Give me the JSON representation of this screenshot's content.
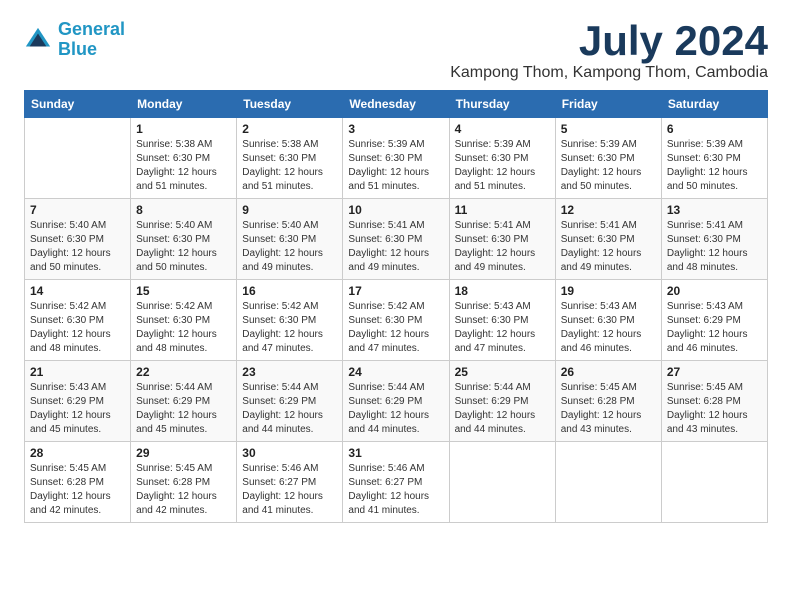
{
  "logo": {
    "line1": "General",
    "line2": "Blue"
  },
  "title": "July 2024",
  "subtitle": "Kampong Thom, Kampong Thom, Cambodia",
  "days_of_week": [
    "Sunday",
    "Monday",
    "Tuesday",
    "Wednesday",
    "Thursday",
    "Friday",
    "Saturday"
  ],
  "weeks": [
    [
      {
        "day": "",
        "sunrise": "",
        "sunset": "",
        "daylight": ""
      },
      {
        "day": "1",
        "sunrise": "Sunrise: 5:38 AM",
        "sunset": "Sunset: 6:30 PM",
        "daylight": "Daylight: 12 hours and 51 minutes."
      },
      {
        "day": "2",
        "sunrise": "Sunrise: 5:38 AM",
        "sunset": "Sunset: 6:30 PM",
        "daylight": "Daylight: 12 hours and 51 minutes."
      },
      {
        "day": "3",
        "sunrise": "Sunrise: 5:39 AM",
        "sunset": "Sunset: 6:30 PM",
        "daylight": "Daylight: 12 hours and 51 minutes."
      },
      {
        "day": "4",
        "sunrise": "Sunrise: 5:39 AM",
        "sunset": "Sunset: 6:30 PM",
        "daylight": "Daylight: 12 hours and 51 minutes."
      },
      {
        "day": "5",
        "sunrise": "Sunrise: 5:39 AM",
        "sunset": "Sunset: 6:30 PM",
        "daylight": "Daylight: 12 hours and 50 minutes."
      },
      {
        "day": "6",
        "sunrise": "Sunrise: 5:39 AM",
        "sunset": "Sunset: 6:30 PM",
        "daylight": "Daylight: 12 hours and 50 minutes."
      }
    ],
    [
      {
        "day": "7",
        "sunrise": "Sunrise: 5:40 AM",
        "sunset": "Sunset: 6:30 PM",
        "daylight": "Daylight: 12 hours and 50 minutes."
      },
      {
        "day": "8",
        "sunrise": "Sunrise: 5:40 AM",
        "sunset": "Sunset: 6:30 PM",
        "daylight": "Daylight: 12 hours and 50 minutes."
      },
      {
        "day": "9",
        "sunrise": "Sunrise: 5:40 AM",
        "sunset": "Sunset: 6:30 PM",
        "daylight": "Daylight: 12 hours and 49 minutes."
      },
      {
        "day": "10",
        "sunrise": "Sunrise: 5:41 AM",
        "sunset": "Sunset: 6:30 PM",
        "daylight": "Daylight: 12 hours and 49 minutes."
      },
      {
        "day": "11",
        "sunrise": "Sunrise: 5:41 AM",
        "sunset": "Sunset: 6:30 PM",
        "daylight": "Daylight: 12 hours and 49 minutes."
      },
      {
        "day": "12",
        "sunrise": "Sunrise: 5:41 AM",
        "sunset": "Sunset: 6:30 PM",
        "daylight": "Daylight: 12 hours and 49 minutes."
      },
      {
        "day": "13",
        "sunrise": "Sunrise: 5:41 AM",
        "sunset": "Sunset: 6:30 PM",
        "daylight": "Daylight: 12 hours and 48 minutes."
      }
    ],
    [
      {
        "day": "14",
        "sunrise": "Sunrise: 5:42 AM",
        "sunset": "Sunset: 6:30 PM",
        "daylight": "Daylight: 12 hours and 48 minutes."
      },
      {
        "day": "15",
        "sunrise": "Sunrise: 5:42 AM",
        "sunset": "Sunset: 6:30 PM",
        "daylight": "Daylight: 12 hours and 48 minutes."
      },
      {
        "day": "16",
        "sunrise": "Sunrise: 5:42 AM",
        "sunset": "Sunset: 6:30 PM",
        "daylight": "Daylight: 12 hours and 47 minutes."
      },
      {
        "day": "17",
        "sunrise": "Sunrise: 5:42 AM",
        "sunset": "Sunset: 6:30 PM",
        "daylight": "Daylight: 12 hours and 47 minutes."
      },
      {
        "day": "18",
        "sunrise": "Sunrise: 5:43 AM",
        "sunset": "Sunset: 6:30 PM",
        "daylight": "Daylight: 12 hours and 47 minutes."
      },
      {
        "day": "19",
        "sunrise": "Sunrise: 5:43 AM",
        "sunset": "Sunset: 6:30 PM",
        "daylight": "Daylight: 12 hours and 46 minutes."
      },
      {
        "day": "20",
        "sunrise": "Sunrise: 5:43 AM",
        "sunset": "Sunset: 6:29 PM",
        "daylight": "Daylight: 12 hours and 46 minutes."
      }
    ],
    [
      {
        "day": "21",
        "sunrise": "Sunrise: 5:43 AM",
        "sunset": "Sunset: 6:29 PM",
        "daylight": "Daylight: 12 hours and 45 minutes."
      },
      {
        "day": "22",
        "sunrise": "Sunrise: 5:44 AM",
        "sunset": "Sunset: 6:29 PM",
        "daylight": "Daylight: 12 hours and 45 minutes."
      },
      {
        "day": "23",
        "sunrise": "Sunrise: 5:44 AM",
        "sunset": "Sunset: 6:29 PM",
        "daylight": "Daylight: 12 hours and 44 minutes."
      },
      {
        "day": "24",
        "sunrise": "Sunrise: 5:44 AM",
        "sunset": "Sunset: 6:29 PM",
        "daylight": "Daylight: 12 hours and 44 minutes."
      },
      {
        "day": "25",
        "sunrise": "Sunrise: 5:44 AM",
        "sunset": "Sunset: 6:29 PM",
        "daylight": "Daylight: 12 hours and 44 minutes."
      },
      {
        "day": "26",
        "sunrise": "Sunrise: 5:45 AM",
        "sunset": "Sunset: 6:28 PM",
        "daylight": "Daylight: 12 hours and 43 minutes."
      },
      {
        "day": "27",
        "sunrise": "Sunrise: 5:45 AM",
        "sunset": "Sunset: 6:28 PM",
        "daylight": "Daylight: 12 hours and 43 minutes."
      }
    ],
    [
      {
        "day": "28",
        "sunrise": "Sunrise: 5:45 AM",
        "sunset": "Sunset: 6:28 PM",
        "daylight": "Daylight: 12 hours and 42 minutes."
      },
      {
        "day": "29",
        "sunrise": "Sunrise: 5:45 AM",
        "sunset": "Sunset: 6:28 PM",
        "daylight": "Daylight: 12 hours and 42 minutes."
      },
      {
        "day": "30",
        "sunrise": "Sunrise: 5:46 AM",
        "sunset": "Sunset: 6:27 PM",
        "daylight": "Daylight: 12 hours and 41 minutes."
      },
      {
        "day": "31",
        "sunrise": "Sunrise: 5:46 AM",
        "sunset": "Sunset: 6:27 PM",
        "daylight": "Daylight: 12 hours and 41 minutes."
      },
      {
        "day": "",
        "sunrise": "",
        "sunset": "",
        "daylight": ""
      },
      {
        "day": "",
        "sunrise": "",
        "sunset": "",
        "daylight": ""
      },
      {
        "day": "",
        "sunrise": "",
        "sunset": "",
        "daylight": ""
      }
    ]
  ]
}
